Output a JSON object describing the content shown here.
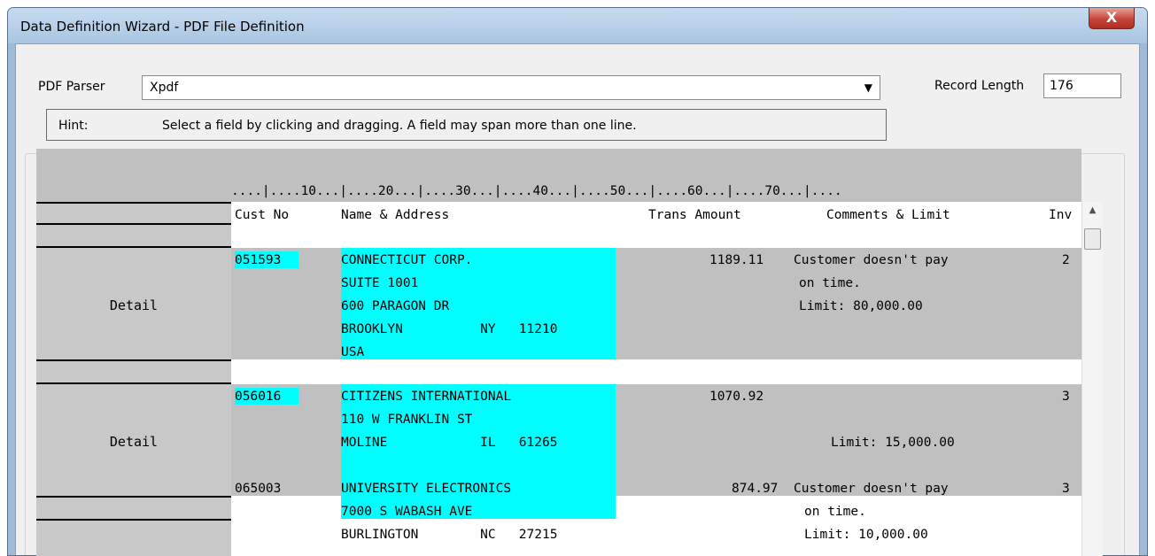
{
  "window": {
    "title": "Data Definition Wizard - PDF File Definition",
    "close_glyph": "X"
  },
  "parser": {
    "label": "PDF Parser",
    "value": "Xpdf",
    "arrow": "▼"
  },
  "record_length": {
    "label": "Record Length",
    "value": "176"
  },
  "hint": {
    "label": "Hint:",
    "text": "Select a field by clicking and dragging. A field may span more than one line."
  },
  "grid": {
    "ruler": "....|....10...|....20...|....30...|....40...|....50...|....60...|....70...|....",
    "header": {
      "cust": "Cust No",
      "name": "Name & Address",
      "amount": "Trans Amount",
      "comments": "Comments & Limit",
      "inv": "Inv"
    },
    "side_labels": [
      "Detail",
      "Detail"
    ],
    "records": [
      {
        "cust": "051593",
        "name_lines": [
          "CONNECTICUT CORP.",
          "SUITE 1001",
          "600 PARAGON DR",
          "BROOKLYN          NY   11210",
          "USA"
        ],
        "amount": "1189.11",
        "comment_lines": [
          "Customer doesn't pay",
          "on time.",
          "Limit: 80,000.00"
        ],
        "inv": "2"
      },
      {
        "cust": "056016",
        "name_lines": [
          "CITIZENS INTERNATIONAL",
          "110 W FRANKLIN ST",
          "MOLINE            IL   61265"
        ],
        "amount": "1070.92",
        "comment_lines": [
          "Limit: 15,000.00"
        ],
        "inv": "3"
      },
      {
        "cust": "065003",
        "name_lines": [
          "UNIVERSITY ELECTRONICS",
          "7000 S WABASH AVE",
          "BURLINGTON        NC   27215"
        ],
        "amount": "874.97",
        "comment_lines": [
          "Customer doesn't pay",
          "on time.",
          "Limit: 10,000.00"
        ],
        "inv": "3"
      }
    ]
  },
  "scrollbar": {
    "up_arrow": "▲"
  },
  "colors": {
    "field_highlight": "#00ffff",
    "detail_band": "#c0c0c0",
    "side_panel": "#c8c8c8"
  }
}
